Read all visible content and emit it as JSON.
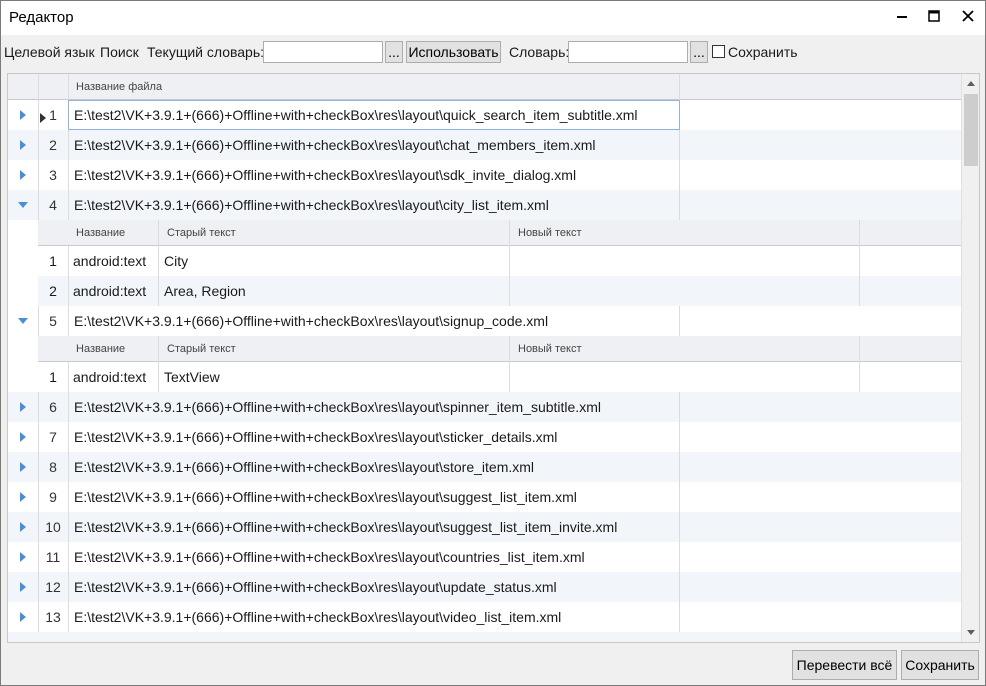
{
  "window": {
    "title": "Редактор",
    "controls": {
      "minimize": "minimize-icon",
      "maximize": "maximize-icon",
      "close": "close-icon"
    }
  },
  "toolbar": {
    "target_language_label": "Целевой язык",
    "search_label": "Поиск",
    "current_dictionary_label": "Текущий словарь:",
    "current_dictionary_value": "",
    "browse_label": "...",
    "use_button": "Использовать",
    "dictionary_label": "Словарь:",
    "dictionary_value": "",
    "browse2_label": "...",
    "save_checkbox_label": "Сохранить",
    "save_checked": false
  },
  "grid": {
    "file_column_header": "Название файла",
    "detail_headers": {
      "name": "Название",
      "old_text": "Старый текст",
      "new_text": "Новый текст"
    },
    "rows": [
      {
        "index": "1",
        "file": "E:\\test2\\VK+3.9.1+(666)+Offline+with+checkBox\\res\\layout\\quick_search_item_subtitle.xml",
        "expanded": false
      },
      {
        "index": "2",
        "file": "E:\\test2\\VK+3.9.1+(666)+Offline+with+checkBox\\res\\layout\\chat_members_item.xml",
        "expanded": false
      },
      {
        "index": "3",
        "file": "E:\\test2\\VK+3.9.1+(666)+Offline+with+checkBox\\res\\layout\\sdk_invite_dialog.xml",
        "expanded": false
      },
      {
        "index": "4",
        "file": "E:\\test2\\VK+3.9.1+(666)+Offline+with+checkBox\\res\\layout\\city_list_item.xml",
        "expanded": true,
        "details": [
          {
            "index": "1",
            "name": "android:text",
            "old_text": "City",
            "new_text": ""
          },
          {
            "index": "2",
            "name": "android:text",
            "old_text": "Area, Region",
            "new_text": ""
          }
        ]
      },
      {
        "index": "5",
        "file": "E:\\test2\\VK+3.9.1+(666)+Offline+with+checkBox\\res\\layout\\signup_code.xml",
        "expanded": true,
        "details": [
          {
            "index": "1",
            "name": "android:text",
            "old_text": "TextView",
            "new_text": ""
          }
        ]
      },
      {
        "index": "6",
        "file": "E:\\test2\\VK+3.9.1+(666)+Offline+with+checkBox\\res\\layout\\spinner_item_subtitle.xml",
        "expanded": false
      },
      {
        "index": "7",
        "file": "E:\\test2\\VK+3.9.1+(666)+Offline+with+checkBox\\res\\layout\\sticker_details.xml",
        "expanded": false
      },
      {
        "index": "8",
        "file": "E:\\test2\\VK+3.9.1+(666)+Offline+with+checkBox\\res\\layout\\store_item.xml",
        "expanded": false
      },
      {
        "index": "9",
        "file": "E:\\test2\\VK+3.9.1+(666)+Offline+with+checkBox\\res\\layout\\suggest_list_item.xml",
        "expanded": false
      },
      {
        "index": "10",
        "file": "E:\\test2\\VK+3.9.1+(666)+Offline+with+checkBox\\res\\layout\\suggest_list_item_invite.xml",
        "expanded": false
      },
      {
        "index": "11",
        "file": "E:\\test2\\VK+3.9.1+(666)+Offline+with+checkBox\\res\\layout\\countries_list_item.xml",
        "expanded": false
      },
      {
        "index": "12",
        "file": "E:\\test2\\VK+3.9.1+(666)+Offline+with+checkBox\\res\\layout\\update_status.xml",
        "expanded": false
      },
      {
        "index": "13",
        "file": "E:\\test2\\VK+3.9.1+(666)+Offline+with+checkBox\\res\\layout\\video_list_item.xml",
        "expanded": false
      }
    ]
  },
  "footer": {
    "translate_all_button": "Перевести всё",
    "save_button": "Сохранить"
  },
  "colors": {
    "window_bg": "#f0f0f0",
    "row_alt": "#f2f6fb",
    "expander_arrow": "#4a8fd6",
    "header_bg": "#eef0f3"
  }
}
